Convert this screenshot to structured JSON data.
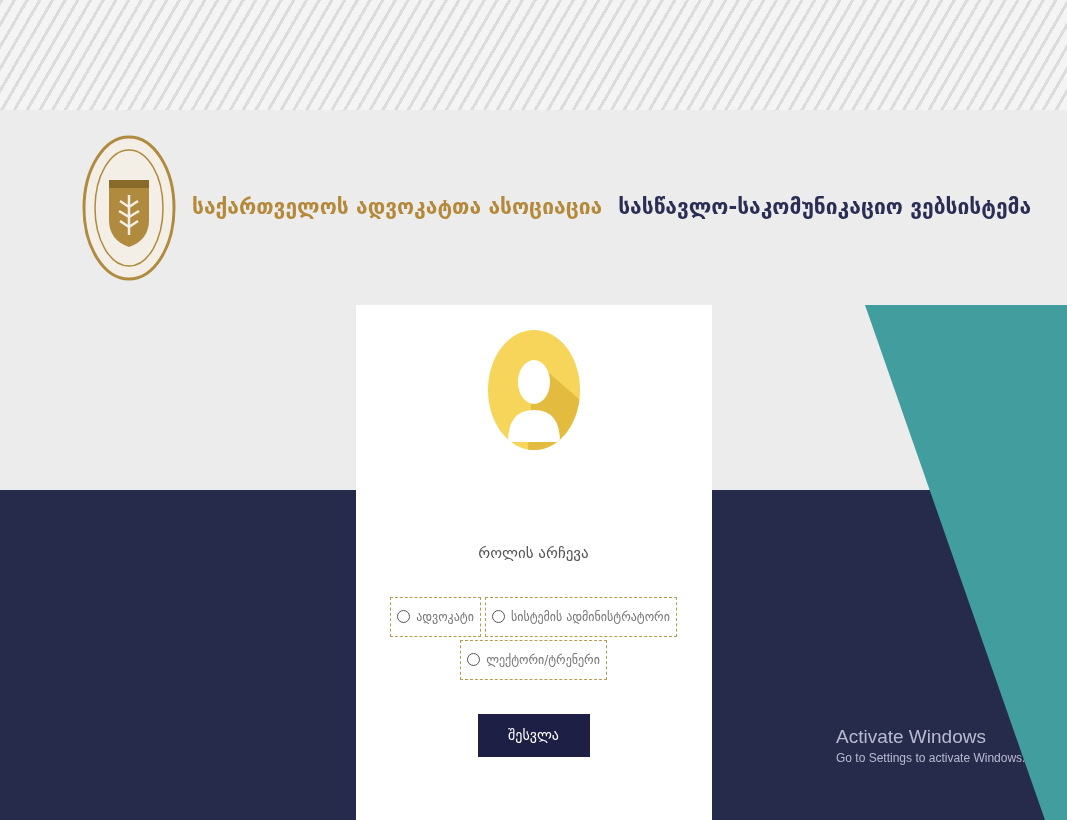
{
  "header": {
    "organization": "საქართველოს ადვოკატთა ასოციაცია",
    "system_title": "სასწავლო-საკომუნიკაციო ვებსისტემა"
  },
  "login": {
    "heading": "როლის არჩევა",
    "roles": [
      {
        "label": "ადვოკატი",
        "selected": false
      },
      {
        "label": "სისტემის ადმინისტრატორი",
        "selected": false
      },
      {
        "label": "ლექტორი/ტრენერი",
        "selected": false
      }
    ],
    "submit": "შესვლა"
  },
  "os_notice": {
    "title": "Activate Windows",
    "subtitle": "Go to Settings to activate Windows."
  }
}
